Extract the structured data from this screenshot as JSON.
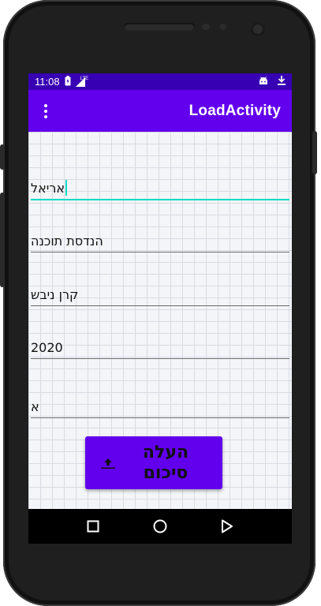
{
  "status_bar": {
    "time": "11:08",
    "network": "LTE"
  },
  "app_bar": {
    "title": "LoadActivity"
  },
  "form": {
    "fields": [
      {
        "value": "אריאל"
      },
      {
        "value": "הנדסת תוכנה"
      },
      {
        "value": "קרן ניבש"
      },
      {
        "value": "2020"
      },
      {
        "value": "א"
      }
    ]
  },
  "upload_button": {
    "label_line1": "העלה",
    "label_line2": "סיכום"
  },
  "colors": {
    "status_bar": "#3700b3",
    "app_bar": "#6200ee",
    "accent": "#03dac5"
  },
  "icons": {
    "menu": "overflow-menu-icon",
    "upload": "upload-icon",
    "back": "back-triangle-icon",
    "home": "home-circle-icon",
    "recents": "recents-square-icon"
  }
}
